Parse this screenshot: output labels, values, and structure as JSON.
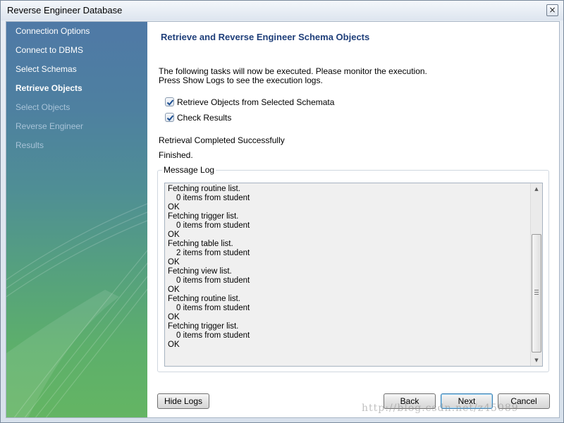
{
  "window": {
    "title": "Reverse Engineer Database",
    "close_glyph": "×"
  },
  "sidebar": {
    "items": [
      {
        "label": "Connection Options",
        "state": "done"
      },
      {
        "label": "Connect to DBMS",
        "state": "done"
      },
      {
        "label": "Select Schemas",
        "state": "done"
      },
      {
        "label": "Retrieve Objects",
        "state": "active"
      },
      {
        "label": "Select Objects",
        "state": "pending"
      },
      {
        "label": "Reverse Engineer",
        "state": "pending"
      },
      {
        "label": "Results",
        "state": "pending"
      }
    ]
  },
  "main": {
    "heading": "Retrieve and Reverse Engineer Schema Objects",
    "intro_line1": "The following tasks will now be executed. Please monitor the execution.",
    "intro_line2": "Press Show Logs to see the execution logs.",
    "tasks": [
      {
        "label": "Retrieve Objects from Selected Schemata",
        "checked": true
      },
      {
        "label": "Check Results",
        "checked": true
      }
    ],
    "status": "Retrieval Completed Successfully",
    "finished": "Finished.",
    "log_title": "Message Log",
    "log_lines": [
      {
        "text": "Fetching routine list.",
        "indent": false
      },
      {
        "text": "0 items from student",
        "indent": true
      },
      {
        "text": "OK",
        "indent": false
      },
      {
        "text": "Fetching trigger list.",
        "indent": false
      },
      {
        "text": "0 items from student",
        "indent": true
      },
      {
        "text": "OK",
        "indent": false
      },
      {
        "text": "Fetching table list.",
        "indent": false
      },
      {
        "text": "2 items from student",
        "indent": true
      },
      {
        "text": "OK",
        "indent": false
      },
      {
        "text": "Fetching view list.",
        "indent": false
      },
      {
        "text": "0 items from student",
        "indent": true
      },
      {
        "text": "OK",
        "indent": false
      },
      {
        "text": "Fetching routine list.",
        "indent": false
      },
      {
        "text": "0 items from student",
        "indent": true
      },
      {
        "text": "OK",
        "indent": false
      },
      {
        "text": "Fetching trigger list.",
        "indent": false
      },
      {
        "text": "0 items from student",
        "indent": true
      },
      {
        "text": "OK",
        "indent": false
      }
    ],
    "scroll_up_glyph": "▲",
    "scroll_down_glyph": "▼"
  },
  "footer": {
    "hide_logs": "Hide Logs",
    "back": "Back",
    "next": "Next",
    "cancel": "Cancel"
  },
  "watermark": "http://blog.csdn.net/z45089",
  "colors": {
    "heading": "#1f3f7a",
    "sidebar_top": "#4f79a6",
    "sidebar_bottom": "#64b563",
    "default_button_border": "#3c7fb1"
  }
}
